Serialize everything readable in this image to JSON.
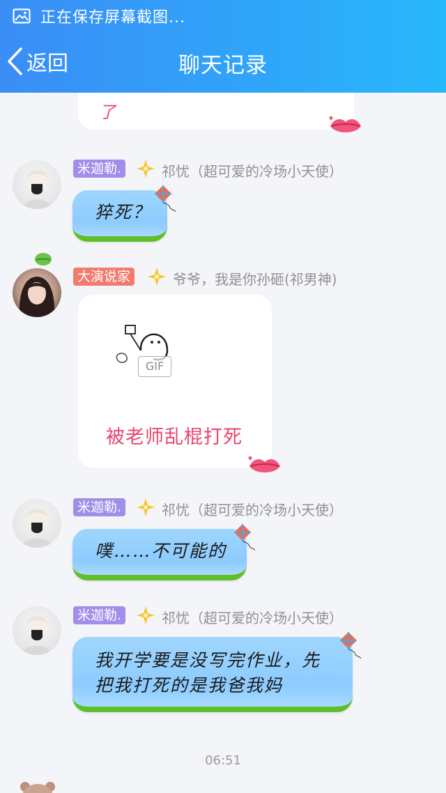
{
  "status_bar": {
    "text": "正在保存屏幕截图...",
    "icon": "image-icon"
  },
  "header": {
    "back_label": "返回",
    "title": "聊天记录"
  },
  "messages": [
    {
      "sender_tag": "",
      "text": "了"
    },
    {
      "sender_tag": "米迦勒.",
      "nickname": "祁忧（超可爱的冷场小天使）",
      "text": "猝死？"
    },
    {
      "sender_tag": "大演说家",
      "nickname": "爷爷，我是你孙砸(祁男神)",
      "gif_label": "GIF",
      "caption": "被老师乱棍打死"
    },
    {
      "sender_tag": "米迦勒.",
      "nickname": "祁忧（超可爱的冷场小天使）",
      "text": "噗……不可能的"
    },
    {
      "sender_tag": "米迦勒.",
      "nickname": "祁忧（超可爱的冷场小天使）",
      "text_line1": "我开学要是没写完作业，先",
      "text_line2": "把我打死的是我爸我妈"
    }
  ],
  "timestamp": "06:51",
  "colors": {
    "header_start": "#3a8df6",
    "header_end": "#28b7fb",
    "tag_purple": "#a08ee9",
    "tag_red": "#f27b6d",
    "caption_red": "#e8456b"
  }
}
